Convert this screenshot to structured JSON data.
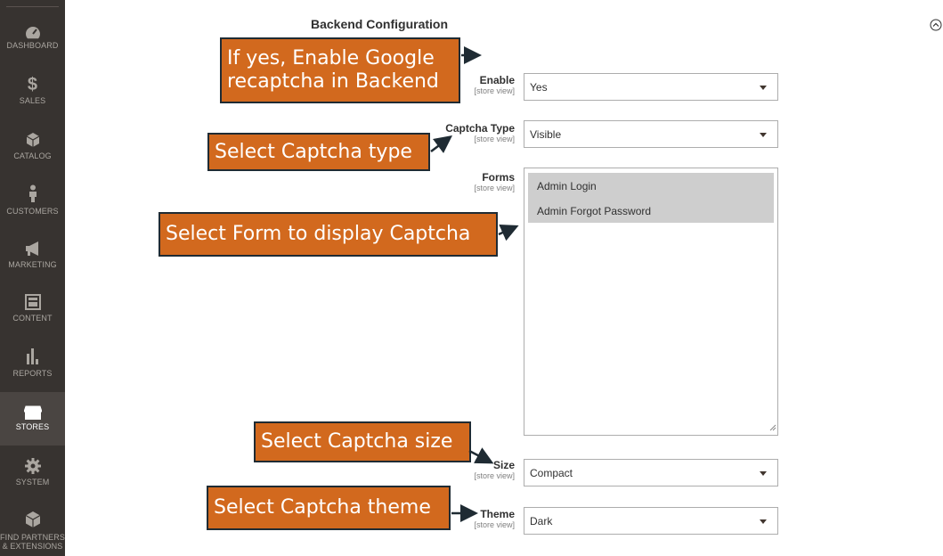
{
  "sidebar": {
    "items": [
      {
        "label": "DASHBOARD",
        "icon": "dashboard-icon"
      },
      {
        "label": "SALES",
        "icon": "dollar-icon"
      },
      {
        "label": "CATALOG",
        "icon": "cube-icon"
      },
      {
        "label": "CUSTOMERS",
        "icon": "person-icon"
      },
      {
        "label": "MARKETING",
        "icon": "megaphone-icon"
      },
      {
        "label": "CONTENT",
        "icon": "layout-icon"
      },
      {
        "label": "REPORTS",
        "icon": "bar-chart-icon"
      },
      {
        "label": "STORES",
        "icon": "store-icon",
        "active": true
      },
      {
        "label": "SYSTEM",
        "icon": "gear-icon"
      },
      {
        "label": "FIND PARTNERS & EXTENSIONS",
        "label_line1": "FIND PARTNERS",
        "label_line2": "& EXTENSIONS",
        "icon": "partners-icon"
      }
    ]
  },
  "section": {
    "title": "Backend Configuration"
  },
  "scope_label": "[store view]",
  "fields": {
    "enable": {
      "label": "Enable",
      "value": "Yes"
    },
    "captcha_type": {
      "label": "Captcha Type",
      "value": "Visible"
    },
    "forms": {
      "label": "Forms",
      "options": [
        "Admin Login",
        "Admin Forgot Password"
      ]
    },
    "size": {
      "label": "Size",
      "value": "Compact"
    },
    "theme": {
      "label": "Theme",
      "value": "Dark"
    }
  },
  "callouts": {
    "enable_line1": "If yes, Enable Google",
    "enable_line2": "recaptcha in Backend",
    "captcha_type": "Select Captcha type",
    "forms": "Select Form to display Captcha",
    "size": "Select Captcha size",
    "theme": "Select Captcha theme"
  },
  "colors": {
    "callout_bg": "#d2691e",
    "callout_border": "#1f2b33",
    "sidebar_bg": "#373330",
    "selected_option": "#cecece"
  }
}
